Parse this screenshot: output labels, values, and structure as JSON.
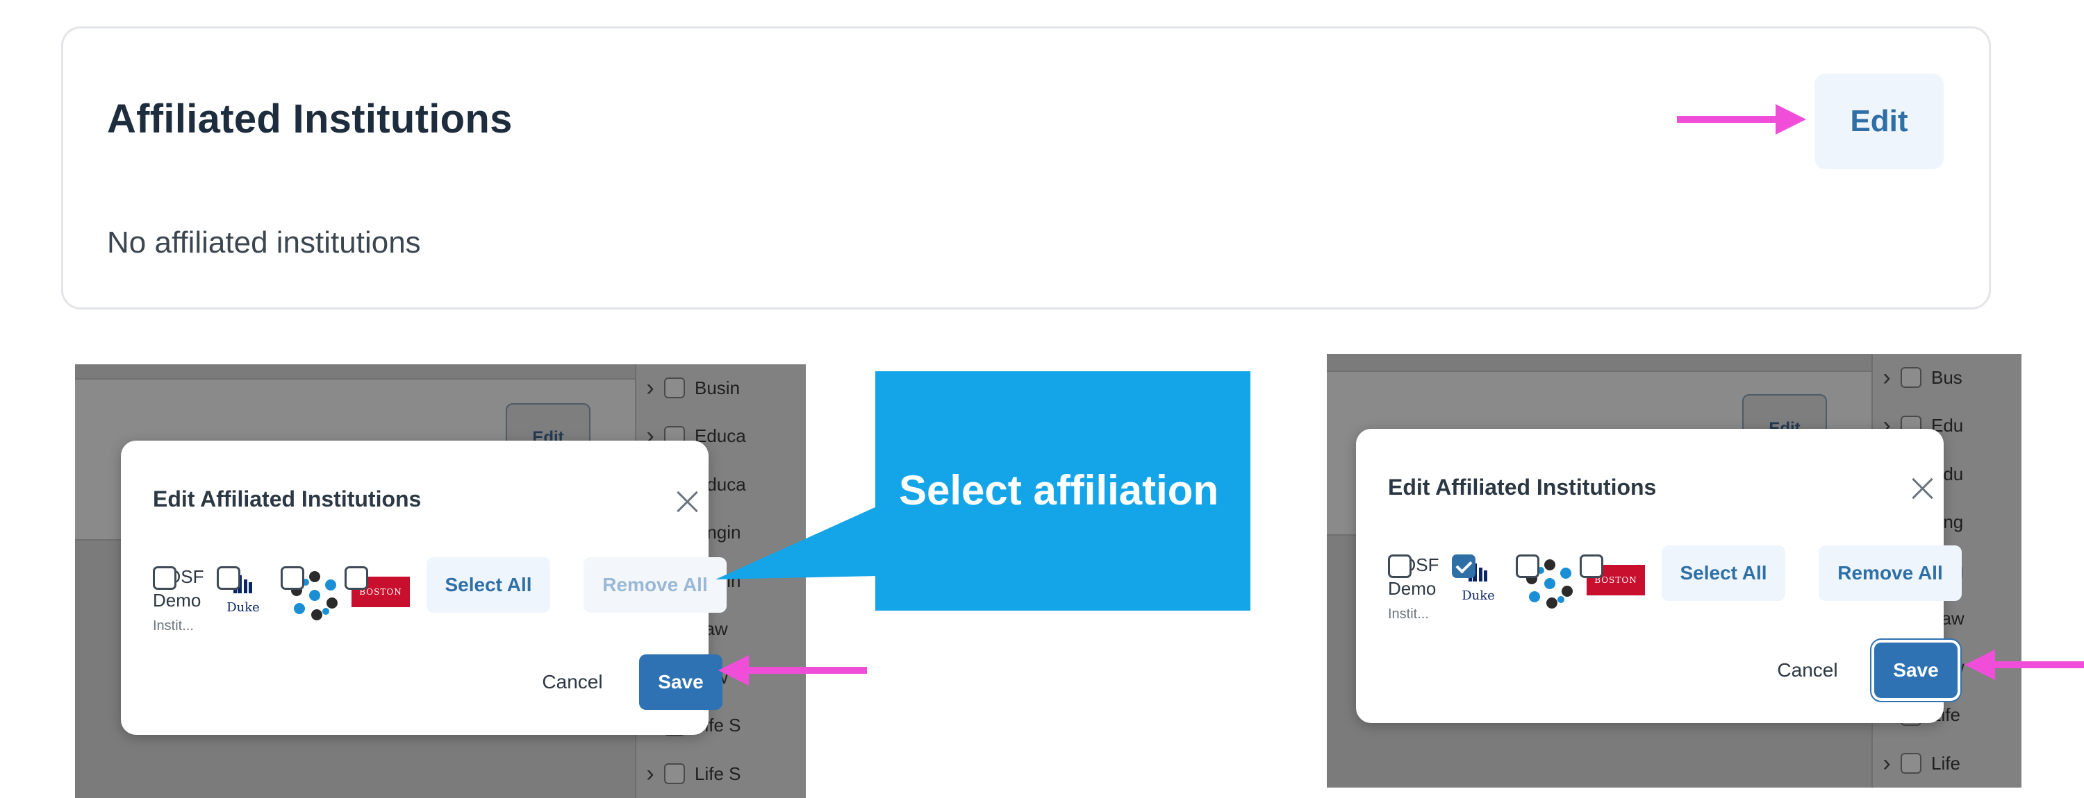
{
  "top_card": {
    "title": "Affiliated Institutions",
    "empty_text": "No affiliated institutions",
    "edit_label": "Edit"
  },
  "callout": {
    "text": "Select affiliation",
    "color": "#14a5e8"
  },
  "annotation_arrow_color": "#f04ed8",
  "panel_left": {
    "background_edit_label": "Edit",
    "sidebar_items": [
      {
        "label": "Busin",
        "chevron": true
      },
      {
        "label": "Educa",
        "chevron": true
      },
      {
        "label": "Educa",
        "chevron": false
      },
      {
        "label": "Engin",
        "chevron": false
      },
      {
        "label": "Engin",
        "chevron": false
      },
      {
        "label": "Law",
        "chevron": false
      },
      {
        "label": "Law",
        "chevron": false
      },
      {
        "label": "Life S",
        "chevron": false
      },
      {
        "label": "Life S",
        "chevron": true
      }
    ],
    "modal": {
      "title": "Edit Affiliated Institutions",
      "osf_line1": "OSF",
      "osf_line2": "Demo",
      "osf_line3": "Instit...",
      "duke_label": "Duke",
      "boston_label": "BOSTON",
      "select_all": "Select All",
      "remove_all": "Remove All",
      "cancel": "Cancel",
      "save": "Save",
      "duke_checked": false
    }
  },
  "panel_right": {
    "background_edit_label": "Edit",
    "sidebar_items": [
      {
        "label": "Bus",
        "chevron": true
      },
      {
        "label": "Edu",
        "chevron": true
      },
      {
        "label": "Edu",
        "chevron": false
      },
      {
        "label": "Eng",
        "chevron": false
      },
      {
        "label": "Eng",
        "chevron": false
      },
      {
        "label": "Law",
        "chevron": false
      },
      {
        "label": "Law",
        "chevron": false
      },
      {
        "label": "Life",
        "chevron": false
      },
      {
        "label": "Life",
        "chevron": true
      }
    ],
    "modal": {
      "title": "Edit Affiliated Institutions",
      "osf_line1": "OSF",
      "osf_line2": "Demo",
      "osf_line3": "Instit...",
      "duke_label": "Duke",
      "boston_label": "BOSTON",
      "select_all": "Select All",
      "remove_all": "Remove All",
      "cancel": "Cancel",
      "save": "Save",
      "duke_checked": true
    }
  }
}
